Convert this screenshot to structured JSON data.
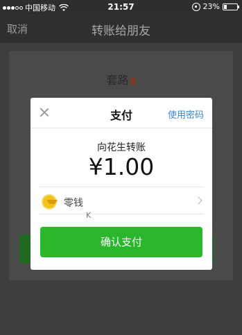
{
  "status_bar": {
    "carrier": "中国移动",
    "time": "21:57",
    "battery": "23%",
    "battery_level": 0.23
  },
  "nav": {
    "cancel_label": "取消",
    "title": "转账给朋友"
  },
  "background": {
    "recipient": "套路"
  },
  "modal": {
    "title": "支付",
    "use_password_label": "使用密码",
    "pay_to": "向花生转账",
    "amount": "¥1.00",
    "payment_method": "零钱",
    "stray_text": "K",
    "confirm_label": "确认支付"
  },
  "colors": {
    "accent_green": "#2ab72c",
    "link_blue": "#3a86d6"
  }
}
